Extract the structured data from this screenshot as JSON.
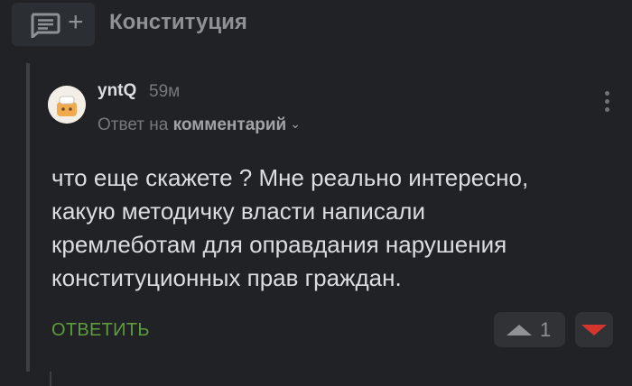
{
  "header": {
    "tag_title": "Конституция",
    "add_icon": "comment-add-icon",
    "plus_glyph": "+"
  },
  "comment": {
    "author": "yntQ",
    "time": "59м",
    "reply_prefix": "Ответ на",
    "reply_target": "комментарий",
    "text": "что еще скажете ? Мне реально интересно,\nкакую методичку власти написали\nкремлеботам для оправдания нарушения\nконституционных прав граждан.",
    "reply_label": "ОТВЕТИТЬ",
    "rating": "1",
    "colors": {
      "reply": "#5e9c3c",
      "downvote": "#d5352d"
    }
  }
}
